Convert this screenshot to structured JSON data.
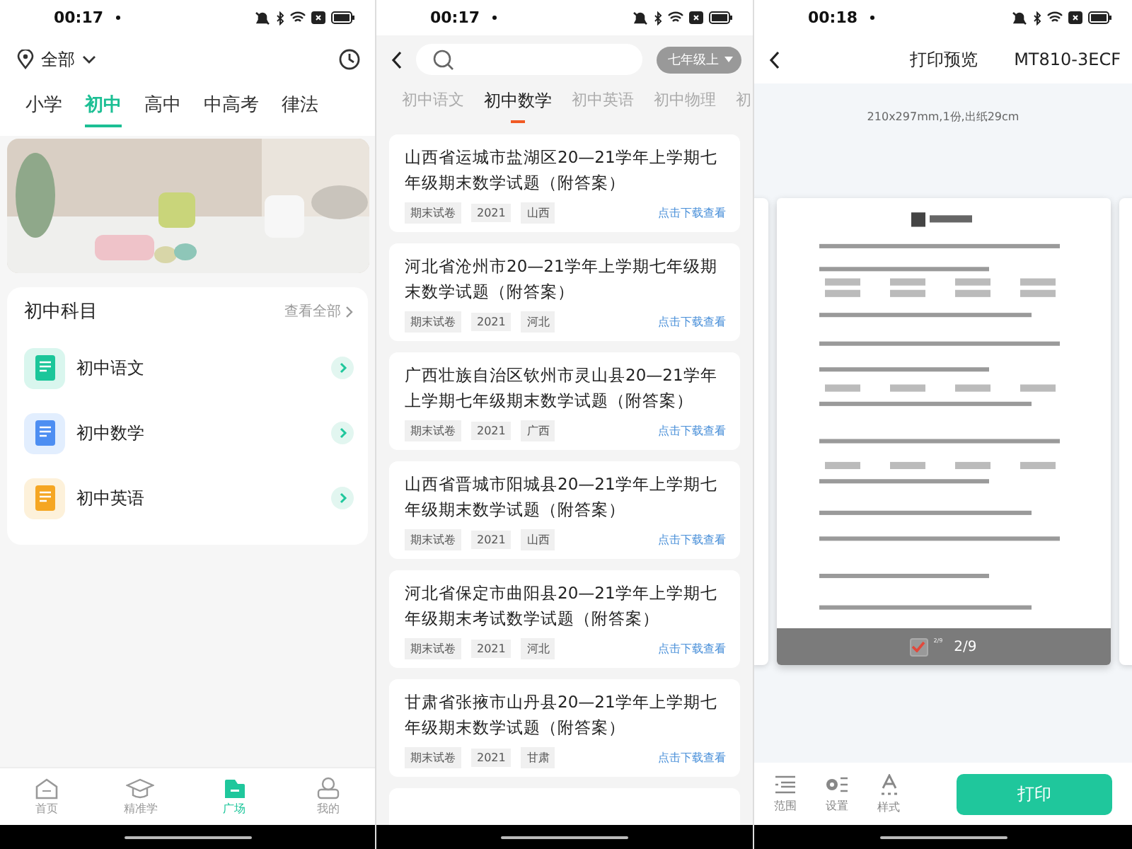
{
  "home_screen": {
    "status_bar": {
      "time": "00:17"
    },
    "location": {
      "label": "全部"
    },
    "tabs": [
      {
        "label": "小学",
        "selected": false
      },
      {
        "label": "初中",
        "selected": true
      },
      {
        "label": "高中",
        "selected": false
      },
      {
        "label": "中高考",
        "selected": false
      },
      {
        "label": "律法",
        "selected": false
      }
    ],
    "subjects_card": {
      "title": "初中科目",
      "view_all": "查看全部",
      "items": [
        {
          "label": "初中语文",
          "kind": "chinese"
        },
        {
          "label": "初中数学",
          "kind": "math"
        },
        {
          "label": "初中英语",
          "kind": "english"
        }
      ]
    },
    "bottom_nav": [
      {
        "label": "首页",
        "kind": "home",
        "selected": false
      },
      {
        "label": "精准学",
        "kind": "study",
        "selected": false
      },
      {
        "label": "广场",
        "kind": "square",
        "selected": true
      },
      {
        "label": "我的",
        "kind": "profile",
        "selected": false
      }
    ]
  },
  "list_screen": {
    "status_bar": {
      "time": "00:17"
    },
    "grade_filter": "七年级上",
    "tabs": [
      {
        "label": "初中语文",
        "selected": false
      },
      {
        "label": "初中数学",
        "selected": true
      },
      {
        "label": "初中英语",
        "selected": false
      },
      {
        "label": "初中物理",
        "selected": false
      },
      {
        "label": "初",
        "selected": false
      }
    ],
    "papers": [
      {
        "title": "山西省运城市盐湖区20—21学年上学期七年级期末数学试题（附答案）",
        "tags": [
          "期末试卷",
          "2021",
          "山西"
        ],
        "action": "点击下载查看"
      },
      {
        "title": "河北省沧州市20—21学年上学期七年级期末数学试题（附答案）",
        "tags": [
          "期末试卷",
          "2021",
          "河北"
        ],
        "action": "点击下载查看"
      },
      {
        "title": "广西壮族自治区钦州市灵山县20—21学年上学期七年级期末数学试题（附答案）",
        "tags": [
          "期末试卷",
          "2021",
          "广西"
        ],
        "action": "点击下载查看"
      },
      {
        "title": "山西省晋城市阳城县20—21学年上学期七年级期末数学试题（附答案）",
        "tags": [
          "期末试卷",
          "2021",
          "山西"
        ],
        "action": "点击下载查看"
      },
      {
        "title": "河北省保定市曲阳县20—21学年上学期七年级期末考试数学试题（附答案）",
        "tags": [
          "期末试卷",
          "2021",
          "河北"
        ],
        "action": "点击下载查看"
      },
      {
        "title": "甘肃省张掖市山丹县20—21学年上学期七年级期末数学试题（附答案）",
        "tags": [
          "期末试卷",
          "2021",
          "甘肃"
        ],
        "action": "点击下载查看"
      }
    ]
  },
  "preview_screen": {
    "status_bar": {
      "time": "00:18"
    },
    "title": "打印预览",
    "device": "MT810-3ECF",
    "paper_info": "210x297mm,1份,出纸29cm",
    "page": {
      "checked": true,
      "small_count": "2/9",
      "count": "2/9"
    },
    "tools": [
      {
        "label": "范围",
        "kind": "range"
      },
      {
        "label": "设置",
        "kind": "settings"
      },
      {
        "label": "样式",
        "kind": "style"
      }
    ],
    "print_button": "打印"
  }
}
